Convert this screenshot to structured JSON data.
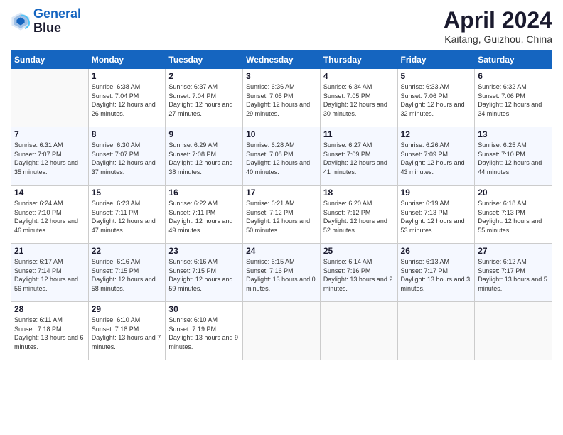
{
  "header": {
    "logo_line1": "General",
    "logo_line2": "Blue",
    "title": "April 2024",
    "location": "Kaitang, Guizhou, China"
  },
  "weekdays": [
    "Sunday",
    "Monday",
    "Tuesday",
    "Wednesday",
    "Thursday",
    "Friday",
    "Saturday"
  ],
  "weeks": [
    [
      {
        "day": "",
        "sunrise": "",
        "sunset": "",
        "daylight": "",
        "empty": true
      },
      {
        "day": "1",
        "sunrise": "Sunrise: 6:38 AM",
        "sunset": "Sunset: 7:04 PM",
        "daylight": "Daylight: 12 hours and 26 minutes."
      },
      {
        "day": "2",
        "sunrise": "Sunrise: 6:37 AM",
        "sunset": "Sunset: 7:04 PM",
        "daylight": "Daylight: 12 hours and 27 minutes."
      },
      {
        "day": "3",
        "sunrise": "Sunrise: 6:36 AM",
        "sunset": "Sunset: 7:05 PM",
        "daylight": "Daylight: 12 hours and 29 minutes."
      },
      {
        "day": "4",
        "sunrise": "Sunrise: 6:34 AM",
        "sunset": "Sunset: 7:05 PM",
        "daylight": "Daylight: 12 hours and 30 minutes."
      },
      {
        "day": "5",
        "sunrise": "Sunrise: 6:33 AM",
        "sunset": "Sunset: 7:06 PM",
        "daylight": "Daylight: 12 hours and 32 minutes."
      },
      {
        "day": "6",
        "sunrise": "Sunrise: 6:32 AM",
        "sunset": "Sunset: 7:06 PM",
        "daylight": "Daylight: 12 hours and 34 minutes."
      }
    ],
    [
      {
        "day": "7",
        "sunrise": "Sunrise: 6:31 AM",
        "sunset": "Sunset: 7:07 PM",
        "daylight": "Daylight: 12 hours and 35 minutes."
      },
      {
        "day": "8",
        "sunrise": "Sunrise: 6:30 AM",
        "sunset": "Sunset: 7:07 PM",
        "daylight": "Daylight: 12 hours and 37 minutes."
      },
      {
        "day": "9",
        "sunrise": "Sunrise: 6:29 AM",
        "sunset": "Sunset: 7:08 PM",
        "daylight": "Daylight: 12 hours and 38 minutes."
      },
      {
        "day": "10",
        "sunrise": "Sunrise: 6:28 AM",
        "sunset": "Sunset: 7:08 PM",
        "daylight": "Daylight: 12 hours and 40 minutes."
      },
      {
        "day": "11",
        "sunrise": "Sunrise: 6:27 AM",
        "sunset": "Sunset: 7:09 PM",
        "daylight": "Daylight: 12 hours and 41 minutes."
      },
      {
        "day": "12",
        "sunrise": "Sunrise: 6:26 AM",
        "sunset": "Sunset: 7:09 PM",
        "daylight": "Daylight: 12 hours and 43 minutes."
      },
      {
        "day": "13",
        "sunrise": "Sunrise: 6:25 AM",
        "sunset": "Sunset: 7:10 PM",
        "daylight": "Daylight: 12 hours and 44 minutes."
      }
    ],
    [
      {
        "day": "14",
        "sunrise": "Sunrise: 6:24 AM",
        "sunset": "Sunset: 7:10 PM",
        "daylight": "Daylight: 12 hours and 46 minutes."
      },
      {
        "day": "15",
        "sunrise": "Sunrise: 6:23 AM",
        "sunset": "Sunset: 7:11 PM",
        "daylight": "Daylight: 12 hours and 47 minutes."
      },
      {
        "day": "16",
        "sunrise": "Sunrise: 6:22 AM",
        "sunset": "Sunset: 7:11 PM",
        "daylight": "Daylight: 12 hours and 49 minutes."
      },
      {
        "day": "17",
        "sunrise": "Sunrise: 6:21 AM",
        "sunset": "Sunset: 7:12 PM",
        "daylight": "Daylight: 12 hours and 50 minutes."
      },
      {
        "day": "18",
        "sunrise": "Sunrise: 6:20 AM",
        "sunset": "Sunset: 7:12 PM",
        "daylight": "Daylight: 12 hours and 52 minutes."
      },
      {
        "day": "19",
        "sunrise": "Sunrise: 6:19 AM",
        "sunset": "Sunset: 7:13 PM",
        "daylight": "Daylight: 12 hours and 53 minutes."
      },
      {
        "day": "20",
        "sunrise": "Sunrise: 6:18 AM",
        "sunset": "Sunset: 7:13 PM",
        "daylight": "Daylight: 12 hours and 55 minutes."
      }
    ],
    [
      {
        "day": "21",
        "sunrise": "Sunrise: 6:17 AM",
        "sunset": "Sunset: 7:14 PM",
        "daylight": "Daylight: 12 hours and 56 minutes."
      },
      {
        "day": "22",
        "sunrise": "Sunrise: 6:16 AM",
        "sunset": "Sunset: 7:15 PM",
        "daylight": "Daylight: 12 hours and 58 minutes."
      },
      {
        "day": "23",
        "sunrise": "Sunrise: 6:16 AM",
        "sunset": "Sunset: 7:15 PM",
        "daylight": "Daylight: 12 hours and 59 minutes."
      },
      {
        "day": "24",
        "sunrise": "Sunrise: 6:15 AM",
        "sunset": "Sunset: 7:16 PM",
        "daylight": "Daylight: 13 hours and 0 minutes."
      },
      {
        "day": "25",
        "sunrise": "Sunrise: 6:14 AM",
        "sunset": "Sunset: 7:16 PM",
        "daylight": "Daylight: 13 hours and 2 minutes."
      },
      {
        "day": "26",
        "sunrise": "Sunrise: 6:13 AM",
        "sunset": "Sunset: 7:17 PM",
        "daylight": "Daylight: 13 hours and 3 minutes."
      },
      {
        "day": "27",
        "sunrise": "Sunrise: 6:12 AM",
        "sunset": "Sunset: 7:17 PM",
        "daylight": "Daylight: 13 hours and 5 minutes."
      }
    ],
    [
      {
        "day": "28",
        "sunrise": "Sunrise: 6:11 AM",
        "sunset": "Sunset: 7:18 PM",
        "daylight": "Daylight: 13 hours and 6 minutes."
      },
      {
        "day": "29",
        "sunrise": "Sunrise: 6:10 AM",
        "sunset": "Sunset: 7:18 PM",
        "daylight": "Daylight: 13 hours and 7 minutes."
      },
      {
        "day": "30",
        "sunrise": "Sunrise: 6:10 AM",
        "sunset": "Sunset: 7:19 PM",
        "daylight": "Daylight: 13 hours and 9 minutes."
      },
      {
        "day": "",
        "sunrise": "",
        "sunset": "",
        "daylight": "",
        "empty": true
      },
      {
        "day": "",
        "sunrise": "",
        "sunset": "",
        "daylight": "",
        "empty": true
      },
      {
        "day": "",
        "sunrise": "",
        "sunset": "",
        "daylight": "",
        "empty": true
      },
      {
        "day": "",
        "sunrise": "",
        "sunset": "",
        "daylight": "",
        "empty": true
      }
    ]
  ]
}
